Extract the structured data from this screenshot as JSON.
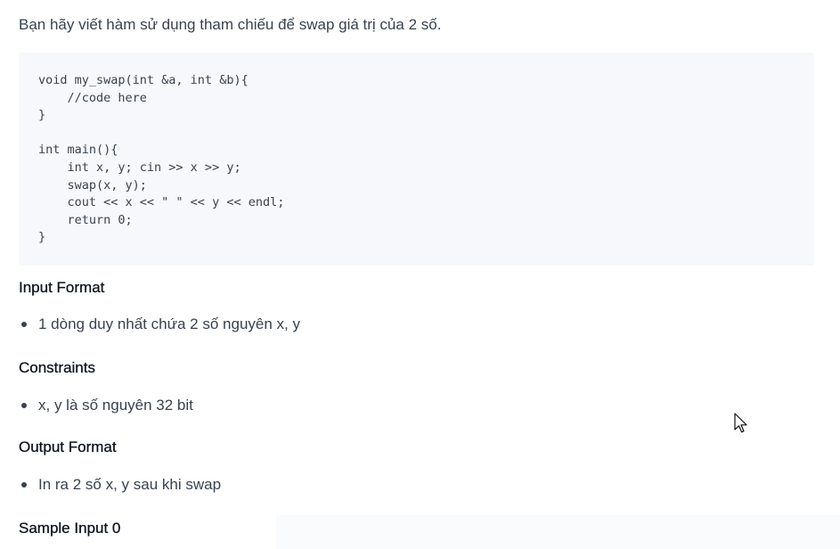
{
  "problem": {
    "intro": "Bạn hãy viết hàm sử dụng tham chiếu để swap giá trị của 2 số.",
    "code_lines": [
      "void my_swap(int &a, int &b){",
      "    //code here",
      "}",
      "",
      "int main(){",
      "    int x, y; cin >> x >> y;",
      "    swap(x, y);",
      "    cout << x << \" \" << y << endl;",
      "    return 0;",
      "}"
    ],
    "input_format": {
      "heading": "Input Format",
      "items": [
        "1 dòng duy nhất chứa 2 số nguyên x, y"
      ]
    },
    "constraints": {
      "heading": "Constraints",
      "items": [
        "x, y là số nguyên 32 bit"
      ]
    },
    "output_format": {
      "heading": "Output Format",
      "items": [
        "In ra 2 số x, y sau khi swap"
      ]
    },
    "sample_input": {
      "heading": "Sample Input 0"
    }
  },
  "icons": {
    "cursor": "mouse-pointer-icon"
  },
  "colors": {
    "text": "#39424e",
    "heading": "#0e141e",
    "code_background": "#f7f8fb"
  }
}
